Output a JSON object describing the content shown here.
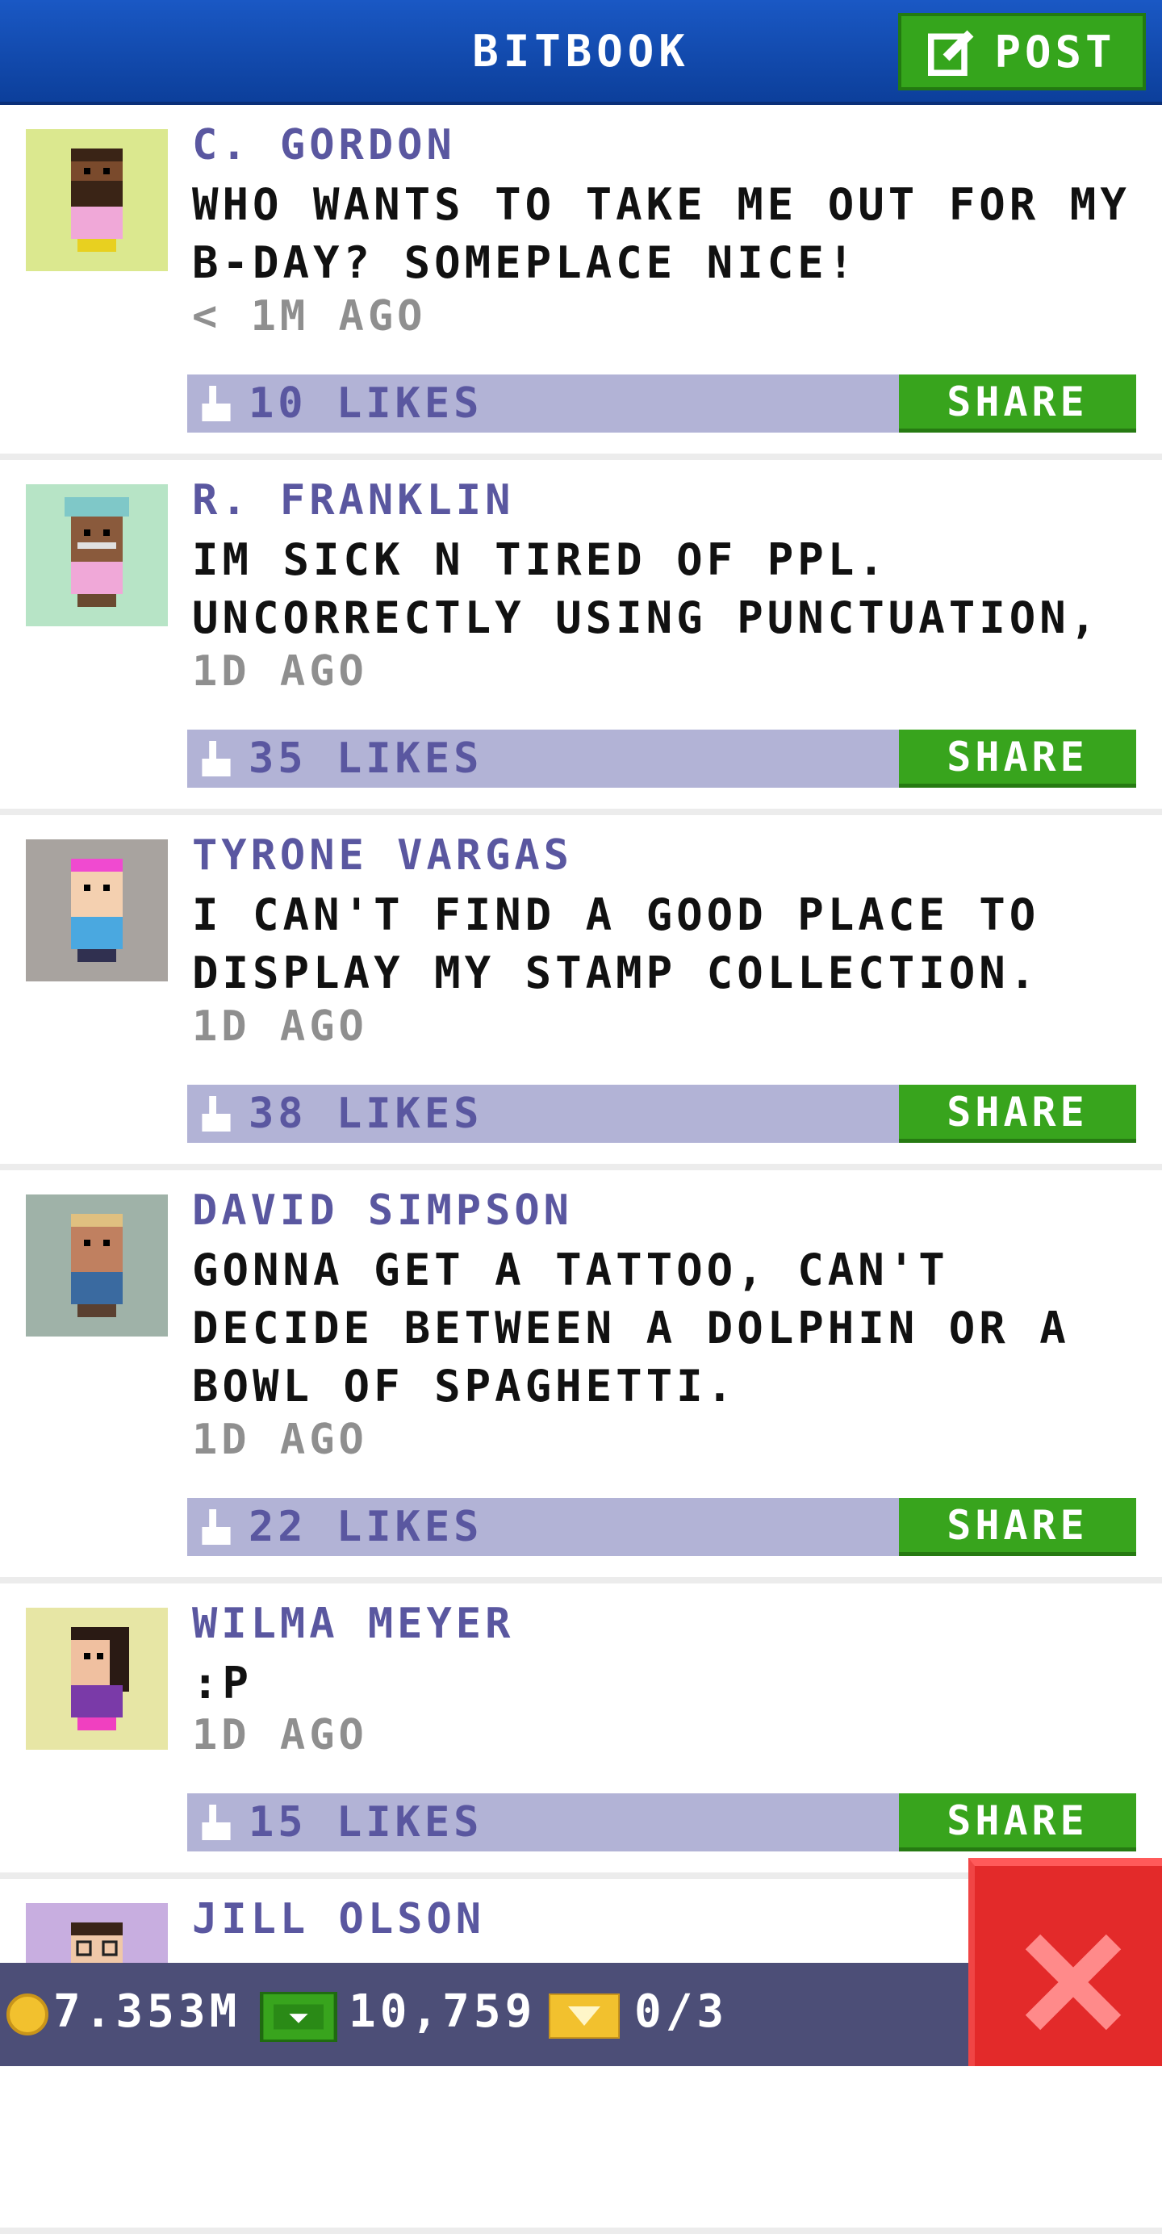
{
  "header": {
    "title": "BITBOOK",
    "post_label": "POST"
  },
  "posts": [
    {
      "name": "C. GORDON",
      "message": "WHO WANTS TO TAKE ME OUT FOR MY B-DAY? SOMEPLACE NICE!",
      "time": "< 1M AGO",
      "likes": "10 LIKES",
      "share": "SHARE",
      "avatar_bg": "#dbe88f"
    },
    {
      "name": "R. FRANKLIN",
      "message": "IM SICK N TIRED OF PPL. UNCORRECTLY USING PUNCTUATION,",
      "time": "1D AGO",
      "likes": "35 LIKES",
      "share": "SHARE",
      "avatar_bg": "#b7e4c6"
    },
    {
      "name": "TYRONE VARGAS",
      "message": "I CAN'T FIND A GOOD PLACE TO DISPLAY MY STAMP COLLECTION.",
      "time": "1D AGO",
      "likes": "38 LIKES",
      "share": "SHARE",
      "avatar_bg": "#a8a39f"
    },
    {
      "name": "DAVID SIMPSON",
      "message": "GONNA GET A TATTOO, CAN'T DECIDE BETWEEN A DOLPHIN OR A BOWL OF SPAGHETTI.",
      "time": "1D AGO",
      "likes": "22 LIKES",
      "share": "SHARE",
      "avatar_bg": "#9fb2a8"
    },
    {
      "name": "WILMA MEYER",
      "message": ":P",
      "time": "1D AGO",
      "likes": "15 LIKES",
      "share": "SHARE",
      "avatar_bg": "#e7e6a5"
    },
    {
      "name": "JILL OLSON",
      "avatar_bg": "#c8aee0"
    }
  ],
  "bottom": {
    "coins": "7.353M",
    "bux": "10,759",
    "tickets": "0/3"
  }
}
